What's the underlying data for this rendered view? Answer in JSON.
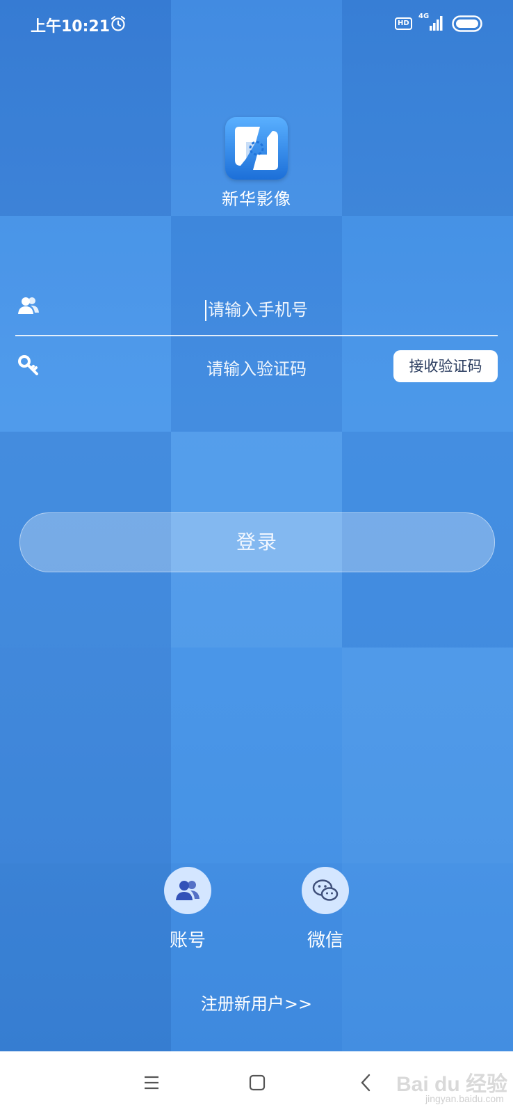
{
  "status_bar": {
    "time": "上午10:21",
    "hd_badge": "HD",
    "network": "4G"
  },
  "app": {
    "name": "新华影像",
    "brand_color": "#3f8fe0"
  },
  "form": {
    "phone_placeholder": "请输入手机号",
    "code_placeholder": "请输入验证码",
    "get_code_label": "接收验证码",
    "login_label": "登录"
  },
  "login_options": [
    {
      "label": "账号",
      "icon": "account-icon"
    },
    {
      "label": "微信",
      "icon": "wechat-icon"
    }
  ],
  "register_link": "注册新用户>>",
  "watermark": {
    "main": "Bai du 经验",
    "sub": "jingyan.baidu.com"
  }
}
